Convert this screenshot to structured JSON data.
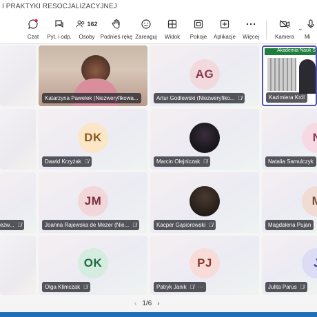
{
  "window": {
    "title": "I PRAKTYKI RESOCJALIZACYJNEJ"
  },
  "toolbar": {
    "chat": "Czat",
    "qa": "Pyt. i odp.",
    "people_count": "162",
    "people": "Osoby",
    "raise": "Podnieś rękę",
    "react": "Zareaguj",
    "view": "Widok",
    "rooms": "Pokoje",
    "apps": "Aplikacje",
    "more": "Więcej",
    "camera": "Kamera",
    "mic": "Mi"
  },
  "participants": {
    "p1": {
      "name": "Katarzyna Pawelek (Niezweryfikowa..."
    },
    "p2": {
      "initials": "AG",
      "name": "Artur Godlewski (Niezweryfiko..."
    },
    "p3": {
      "banner": "Akademia Nauk Sto",
      "name": "Kazimiera Król"
    },
    "p4": {
      "initials": "DK",
      "name": "Dawid Krzyżak"
    },
    "p5": {
      "name": "Marcin Olejniczak"
    },
    "p6": {
      "initials": "N",
      "name": "Natalia Samulczyk"
    },
    "p7": {
      "name": "ezw..."
    },
    "p8": {
      "initials": "JM",
      "name": "Joanna Rajewska de Mezer (Nie..."
    },
    "p9": {
      "name": "Kacper Gąsiorowski"
    },
    "p10": {
      "initials": "M",
      "name": "Magdalena Pujan"
    },
    "p11": {
      "initials": "OK",
      "name": "Olga Klimczak"
    },
    "p12": {
      "initials": "PJ",
      "name": "Patryk Janik"
    },
    "p13": {
      "initials": "J",
      "name": "Julita Parus"
    }
  },
  "pager": {
    "prev": "‹",
    "label": "1/6",
    "next": "›"
  },
  "colors": {
    "accent": "#1e6fb6",
    "mic_off": "#ffffff"
  }
}
